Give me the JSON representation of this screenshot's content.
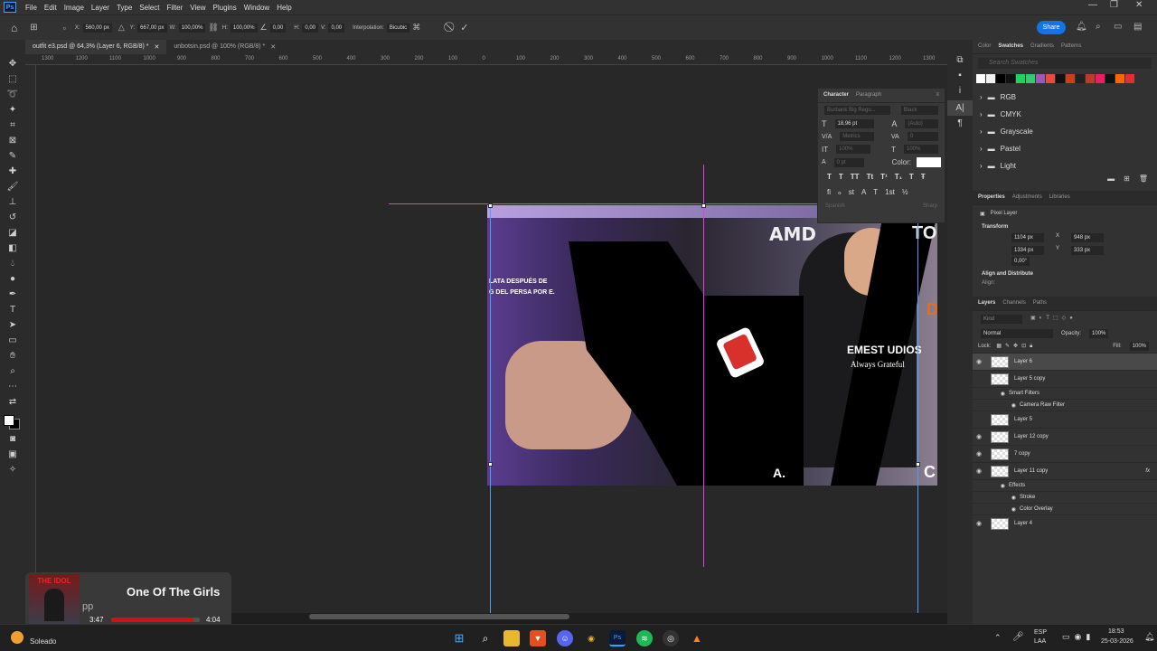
{
  "menubar": {
    "logo": "Ps",
    "items": [
      "File",
      "Edit",
      "Image",
      "Layer",
      "Type",
      "Select",
      "Filter",
      "View",
      "Plugins",
      "Window",
      "Help"
    ]
  },
  "options": {
    "x_label": "X:",
    "x_value": "560,00 px",
    "y_label": "Y:",
    "y_value": "667,00 px",
    "w_label": "W:",
    "w_value": "100,00%",
    "h_label": "H:",
    "h_value": "100,00%",
    "angle_value": "0,00",
    "h_skew_label": "H:",
    "h_skew_value": "0,00",
    "v_skew_label": "V:",
    "v_skew_value": "0,00",
    "interp_label": "Interpolation:",
    "interp_value": "Bicubic",
    "share": "Share"
  },
  "tabs": [
    {
      "label": "outfit e3.psd @ 64,3% (Layer 6, RGB/8) *"
    },
    {
      "label": "unbotsin.psd @ 100% (RGB/8) *"
    }
  ],
  "ruler_ticks": [
    "1300",
    "1200",
    "1100",
    "1000",
    "900",
    "800",
    "700",
    "600",
    "500",
    "400",
    "300",
    "200",
    "100",
    "0",
    "100",
    "200",
    "300",
    "400",
    "500",
    "600",
    "700",
    "800",
    "900",
    "1000",
    "1100",
    "1200",
    "1300"
  ],
  "canvas_texts": {
    "line1": "LATA DESPUÉS DE",
    "line2": "G DEL PERSA POR E.",
    "amd": "AMD",
    "to": "TO",
    "studio": "EMEST UDIOS",
    "always": "Always Grateful",
    "letter_a": "A.",
    "side_d": "D",
    "side_c": "C"
  },
  "character": {
    "tab1": "Character",
    "tab2": "Paragraph",
    "font": "Burbank Big Regu...",
    "style": "Black",
    "size": "18,96 pt",
    "leading": "(Auto)",
    "kerning": "Metrics",
    "tracking": "0",
    "vscale": "100%",
    "hscale": "100%",
    "baseline": "0 pt",
    "color_label": "Color:",
    "language": "Spanish",
    "aa": "Sharp"
  },
  "swatches": {
    "tabs": [
      "Color",
      "Swatches",
      "Gradients",
      "Patterns"
    ],
    "search": "Search Swatches",
    "colors": [
      "#ffffff",
      "#f0f0f0",
      "#000000",
      "#111111",
      "#20d060",
      "#2ecc71",
      "#9b59b6",
      "#e74c3c",
      "#111111",
      "#d63a1a",
      "#222222",
      "#c0392b",
      "#e91e63",
      "#111111",
      "#ff6600",
      "#e03030"
    ],
    "folders": [
      "RGB",
      "CMYK",
      "Grayscale",
      "Pastel",
      "Light"
    ]
  },
  "properties": {
    "tabs": [
      "Properties",
      "Adjustments",
      "Libraries"
    ],
    "kind": "Pixel Layer",
    "transform": "Transform",
    "w": "1104 px",
    "x": "948 px",
    "h": "1334 px",
    "y": "333 px",
    "angle": "0,00°",
    "align": "Align and Distribute",
    "align_label": "Align:"
  },
  "layers": {
    "tabs": [
      "Layers",
      "Channels",
      "Paths"
    ],
    "kind": "Kind",
    "blend": "Normal",
    "opacity_label": "Opacity:",
    "opacity": "100%",
    "lock_label": "Lock:",
    "fill_label": "Fill:",
    "fill": "100%",
    "items": [
      {
        "name": "Layer 6",
        "visible": true,
        "selected": true,
        "indent": 0
      },
      {
        "name": "Layer 5 copy",
        "visible": false,
        "selected": false,
        "indent": 0
      },
      {
        "name": "Smart Filters",
        "visible": true,
        "selected": false,
        "indent": 1
      },
      {
        "name": "Camera Raw Filter",
        "visible": true,
        "selected": false,
        "indent": 2
      },
      {
        "name": "Layer 5",
        "visible": false,
        "selected": false,
        "indent": 0
      },
      {
        "name": "Layer 12 copy",
        "visible": true,
        "selected": false,
        "indent": 0
      },
      {
        "name": "7 copy",
        "visible": true,
        "selected": false,
        "indent": 0
      },
      {
        "name": "Layer 11 copy",
        "visible": true,
        "selected": false,
        "indent": 0,
        "fx": "fx"
      },
      {
        "name": "Effects",
        "visible": true,
        "selected": false,
        "indent": 1
      },
      {
        "name": "Stroke",
        "visible": true,
        "selected": false,
        "indent": 2
      },
      {
        "name": "Color Overlay",
        "visible": true,
        "selected": false,
        "indent": 2
      },
      {
        "name": "Layer 4",
        "visible": true,
        "selected": false,
        "indent": 0
      }
    ]
  },
  "music": {
    "album": "THE IDOL",
    "title": "One Of The Girls",
    "app": "pp",
    "elapsed": "3:47",
    "total": "4:04",
    "progress": 0.93
  },
  "taskbar": {
    "weather": "Soleado",
    "lang1": "ESP",
    "lang2": "LAA",
    "time": "18:53",
    "date": "25-03-2026"
  },
  "colors": {
    "accent": "#1473e6",
    "guide": "#e040e0",
    "ps_blue": "#31a8ff"
  }
}
